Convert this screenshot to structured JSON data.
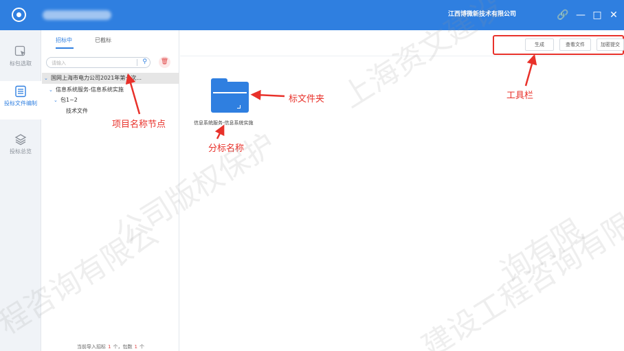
{
  "titlebar": {
    "app_name": "",
    "company": "江西博微新技术有限公司",
    "link_icon": "link-icon",
    "minimize_icon": "minimize-icon",
    "maximize_icon": "maximize-icon",
    "close_icon": "close-icon"
  },
  "leftnav": {
    "items": [
      {
        "label": "标包选取",
        "icon": "cursor-icon"
      },
      {
        "label": "投标文件编制",
        "icon": "document-list-icon",
        "active": true
      },
      {
        "label": "投标总览",
        "icon": "layers-icon"
      }
    ]
  },
  "tree_panel": {
    "tabs": [
      {
        "label": "招标中",
        "active": true
      },
      {
        "label": "已截标"
      }
    ],
    "search": {
      "placeholder": "请输入",
      "value": ""
    },
    "nodes": [
      {
        "caret": "⌄",
        "label": "国网上海市电力公司2021年第七次..."
      },
      {
        "caret": "⌄",
        "label": "信息系统服务-信息系统实施"
      },
      {
        "caret": "⌄",
        "label": "包1~2"
      },
      {
        "caret": "",
        "label": "技术文件"
      }
    ],
    "status": {
      "prefix": "当前导入招标",
      "count": "1",
      "middle": "个，包数",
      "packages": "1",
      "suffix": "个"
    }
  },
  "main": {
    "toolbar": {
      "generate": "生成",
      "view_files": "查看文件",
      "encrypt_submit": "加密提交"
    },
    "folder": {
      "caption": "信息系统服务-信息系统实施"
    }
  },
  "annotations": {
    "toolbar": "工具栏",
    "folder": "标文件夹",
    "sub_name": "分标名称",
    "project_node": "项目名称节点"
  },
  "watermark": {
    "lines": [
      "上海资文建设",
      "公司版权保护",
      "程咨询有限公",
      "建设工程咨询有限",
      "询有限"
    ]
  },
  "colors": {
    "brand": "#2f7fe0",
    "annotation": "#e8312a",
    "selected_row": "#e6e6e6"
  }
}
